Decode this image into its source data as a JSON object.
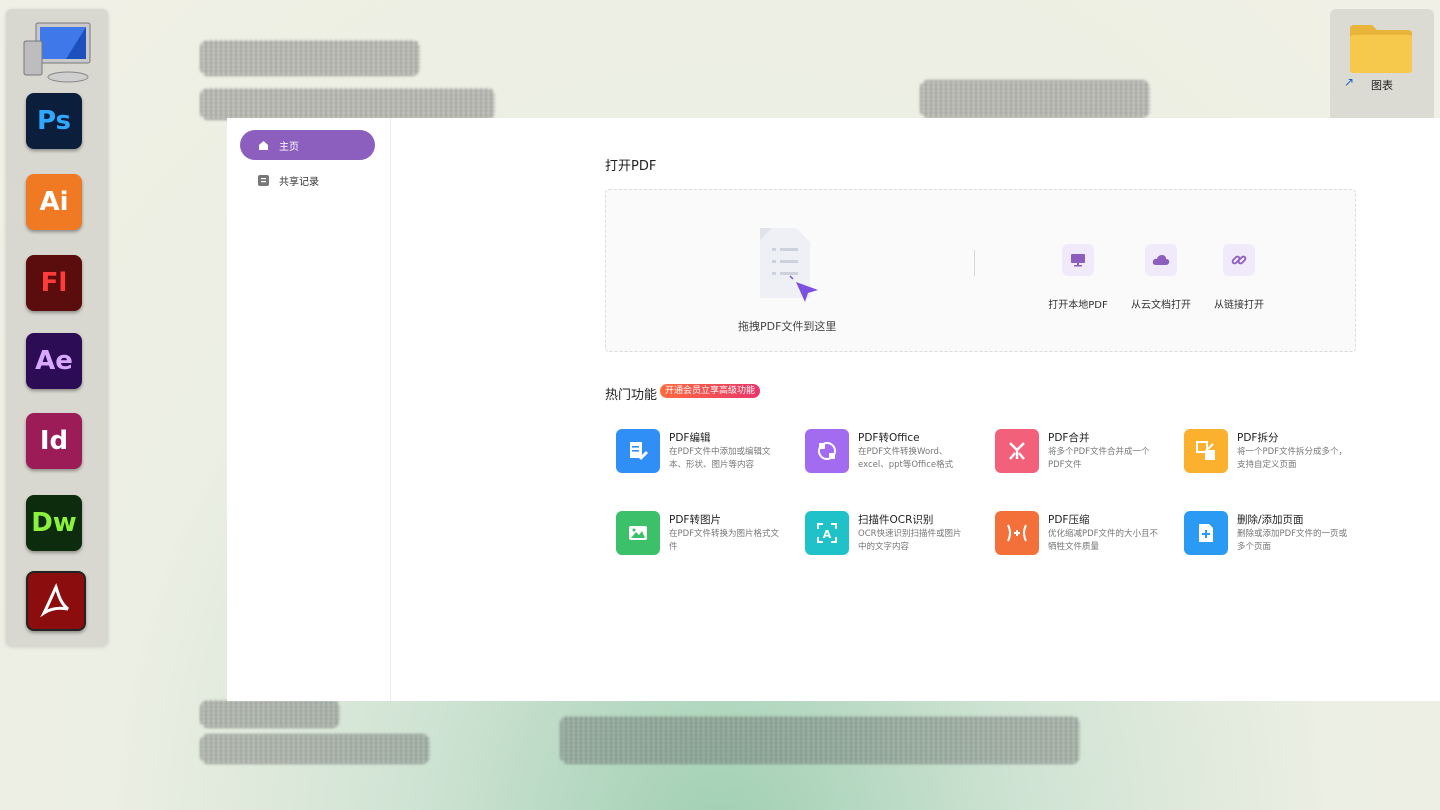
{
  "desktop": {
    "dock_apps": [
      {
        "name": "Ps",
        "color": "#31a8ff",
        "bg": "#0b1f3d"
      },
      {
        "name": "Ai",
        "color": "#fff",
        "bg": "#f07a23"
      },
      {
        "name": "Fl",
        "color": "#ff3b3b",
        "bg": "#5b0c0c"
      },
      {
        "name": "Ae",
        "color": "#d8a8ff",
        "bg": "#2b0c55"
      },
      {
        "name": "Id",
        "color": "#fff",
        "bg": "#9c1c58"
      },
      {
        "name": "Dw",
        "color": "#8cf23c",
        "bg": "#0d2b0d"
      }
    ],
    "folder_label": "图表"
  },
  "sidebar": {
    "items": [
      {
        "label": "主页",
        "icon": "home-icon",
        "active": true
      },
      {
        "label": "共享记录",
        "icon": "document-icon",
        "active": false
      }
    ]
  },
  "open_section": {
    "title": "打开PDF",
    "drop_label": "拖拽PDF文件到这里",
    "options": [
      {
        "label": "打开本地PDF",
        "icon": "monitor-icon"
      },
      {
        "label": "从云文档打开",
        "icon": "cloud-icon"
      },
      {
        "label": "从链接打开",
        "icon": "link-icon"
      }
    ]
  },
  "features_section": {
    "title": "热门功能",
    "promo": "开通会员立享高级功能",
    "features": [
      {
        "title": "PDF编辑",
        "desc": "在PDF文件中添加或编辑文本、形状、图片等内容",
        "color": "#2f8ff6",
        "icon": "edit-icon"
      },
      {
        "title": "PDF转Office",
        "desc": "在PDF文件转换Word、excel、ppt等Office格式",
        "color": "#a26bf0",
        "icon": "convert-icon"
      },
      {
        "title": "PDF合并",
        "desc": "将多个PDF文件合并成一个PDF文件",
        "color": "#f2607a",
        "icon": "merge-icon"
      },
      {
        "title": "PDF拆分",
        "desc": "将一个PDF文件拆分成多个，支持自定义页面",
        "color": "#fbb02e",
        "icon": "split-icon"
      },
      {
        "title": "PDF转图片",
        "desc": "在PDF文件转换为图片格式文件",
        "color": "#3cc06a",
        "icon": "image-icon"
      },
      {
        "title": "扫描件OCR识别",
        "desc": "OCR快速识别扫描件或图片中的文字内容",
        "color": "#1fc2c9",
        "icon": "ocr-icon"
      },
      {
        "title": "PDF压缩",
        "desc": "优化缩减PDF文件的大小且不牺牲文件质量",
        "color": "#f4703b",
        "icon": "compress-icon"
      },
      {
        "title": "删除/添加页面",
        "desc": "删除或添加PDF文件的一页或多个页面",
        "color": "#2b9af3",
        "icon": "page-add-icon"
      }
    ]
  }
}
